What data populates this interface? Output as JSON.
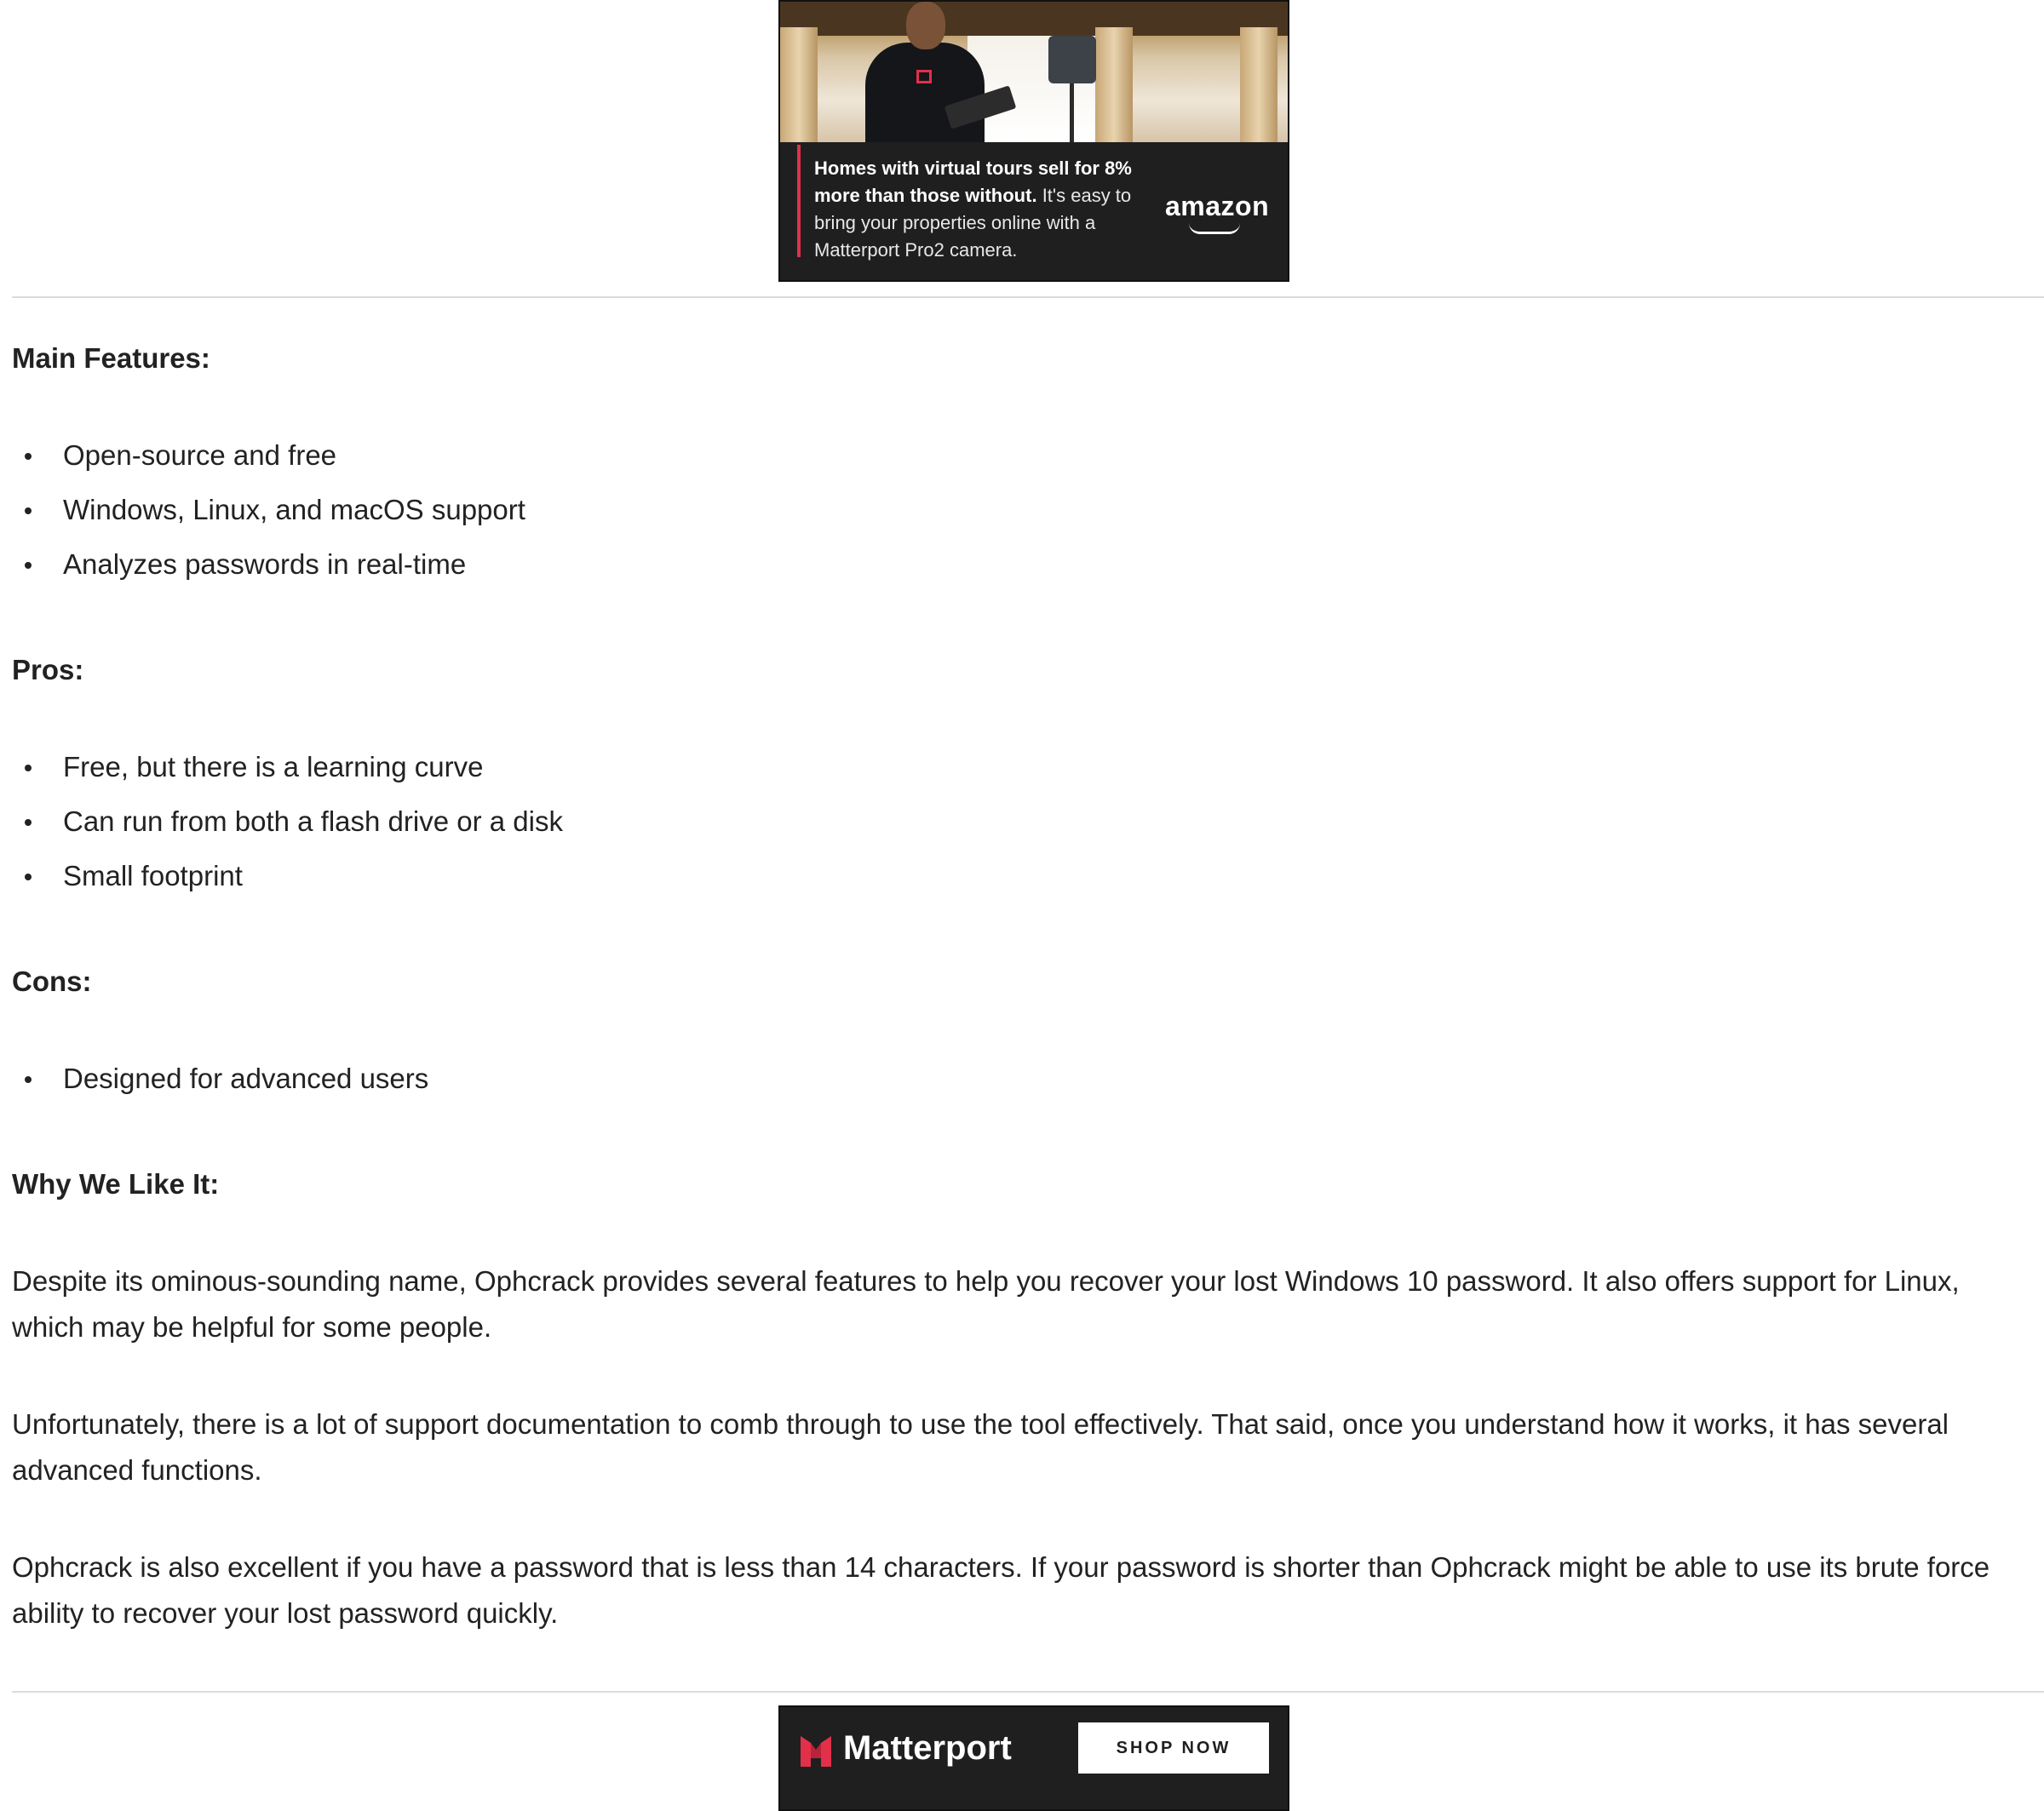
{
  "top_ad": {
    "headline_bold": "Homes with virtual tours sell for 8% more than those without.",
    "body": "It's easy to bring your properties online with a Matterport Pro2 camera.",
    "brand": "amazon",
    "accent_color": "#e2304a"
  },
  "sections": {
    "features": {
      "heading": "Main Features:",
      "items": [
        "Open-source and free",
        "Windows, Linux, and macOS support",
        "Analyzes passwords in real-time"
      ]
    },
    "pros": {
      "heading": "Pros:",
      "items": [
        "Free, but there is a learning curve",
        "Can run from both a flash drive or a disk",
        "Small footprint"
      ]
    },
    "cons": {
      "heading": "Cons:",
      "items": [
        "Designed for advanced users"
      ]
    },
    "why": {
      "heading": "Why We Like It:",
      "paragraphs": [
        "Despite its ominous-sounding name, Ophcrack provides several features to help you recover your lost Windows 10 password. It also offers support for Linux, which may be helpful for some people.",
        "Unfortunately, there is a lot of support documentation to comb through to use the tool effectively. That said, once you understand how it works, it has several advanced functions.",
        "Ophcrack is also excellent if you have a password that is less than 14 characters. If your password is shorter than Ophcrack might be able to use its brute force ability to recover your lost password quickly."
      ]
    }
  },
  "bottom_ad": {
    "brand": "Matterport",
    "button_label": "SHOP NOW",
    "logo_icon": "matterport-logo-icon"
  }
}
